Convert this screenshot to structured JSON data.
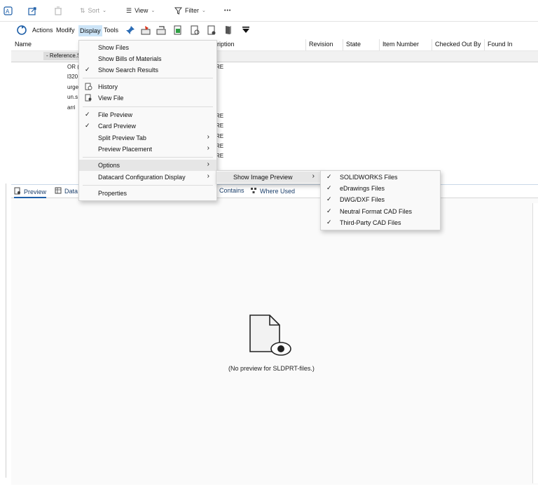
{
  "toolbar": {
    "sort_label": "Sort",
    "view_label": "View",
    "filter_label": "Filter",
    "more_label": "•••"
  },
  "menubar": {
    "actions": "Actions",
    "modify": "Modify",
    "display": "Display",
    "tools": "Tools"
  },
  "columns": [
    "Name",
    "ription",
    "Revision",
    "State",
    "Item Number",
    "Checked Out By",
    "Found In"
  ],
  "list": {
    "reference_label": "- Reference.S",
    "partial_rows": [
      "OR (",
      "l320",
      "urge",
      "un.s",
      "arri"
    ],
    "partial_col": [
      "RE",
      "RE",
      "RE",
      "RE",
      "RE",
      "RE"
    ]
  },
  "display_menu": {
    "items": [
      {
        "label": "Show Files",
        "checked": false
      },
      {
        "label": "Show Bills of Materials",
        "checked": false
      },
      {
        "label": "Show Search Results",
        "checked": true
      },
      {
        "label": "History",
        "checked": false
      },
      {
        "label": "View File",
        "checked": false
      },
      {
        "label": "File Preview",
        "checked": true
      },
      {
        "label": "Card Preview",
        "checked": true
      },
      {
        "label": "Split Preview Tab",
        "checked": false
      },
      {
        "label": "Preview Placement",
        "checked": false
      },
      {
        "label": "Options",
        "checked": false
      },
      {
        "label": "Datacard Configuration Display",
        "checked": false
      },
      {
        "label": "Properties",
        "checked": false
      }
    ]
  },
  "options_submenu": {
    "item": "Show Image Preview"
  },
  "image_preview_submenu": {
    "items": [
      {
        "label": "SOLIDWORKS Files",
        "checked": true
      },
      {
        "label": "eDrawings Files",
        "checked": true
      },
      {
        "label": "DWG/DXF Files",
        "checked": true
      },
      {
        "label": "Neutral Format CAD Files",
        "checked": true
      },
      {
        "label": "Third-Party CAD Files",
        "checked": true
      }
    ]
  },
  "tabs": {
    "preview": "Preview",
    "data": "Data",
    "contains": "Contains",
    "where_used": "Where Used"
  },
  "preview": {
    "message": "(No preview for SLDPRT-files.)"
  },
  "icons": {
    "accent": "#1e5fa8",
    "check_color": "#222222"
  }
}
